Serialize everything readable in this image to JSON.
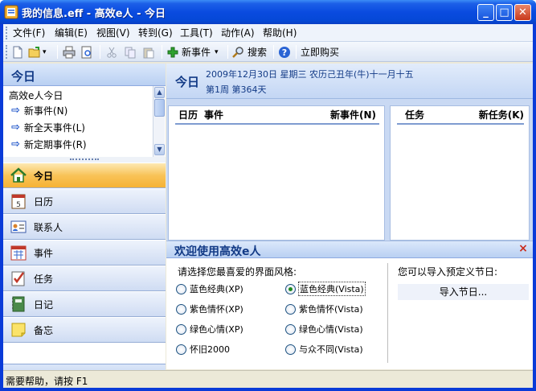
{
  "window": {
    "title": "我的信息.eff - 高效e人 - 今日",
    "min_glyph": "_",
    "max_glyph": "□",
    "close_glyph": "✕"
  },
  "menu": {
    "file": "文件(F)",
    "edit": "编辑(E)",
    "view": "视图(V)",
    "goto": "转到(G)",
    "tools": "工具(T)",
    "action": "动作(A)",
    "help": "帮助(H)"
  },
  "toolbar": {
    "new_event": "新事件",
    "search": "搜索",
    "buy_now": "立即购买",
    "dropdown_glyph": "▾"
  },
  "left": {
    "header": "今日",
    "subtitle": "高效e人今日",
    "quick_items": [
      {
        "label": "新事件(N)"
      },
      {
        "label": "新全天事件(L)"
      },
      {
        "label": "新定期事件(R)"
      }
    ],
    "nav": [
      {
        "label": "今日",
        "icon": "home-icon",
        "active": true
      },
      {
        "label": "日历",
        "icon": "calendar-icon",
        "active": false
      },
      {
        "label": "联系人",
        "icon": "contacts-icon",
        "active": false
      },
      {
        "label": "事件",
        "icon": "events-icon",
        "active": false
      },
      {
        "label": "任务",
        "icon": "tasks-icon",
        "active": false
      },
      {
        "label": "日记",
        "icon": "diary-icon",
        "active": false
      },
      {
        "label": "备忘",
        "icon": "memo-icon",
        "active": false
      }
    ],
    "footer_more_glyph": "»"
  },
  "date": {
    "heading": "今日",
    "line1": "2009年12月30日  星期三  农历己丑年(牛)十一月十五",
    "line2": "第1周  第364天"
  },
  "calendar_panel": {
    "col_calendar": "日历",
    "col_event": "事件",
    "new_event": "新事件(N)"
  },
  "task_panel": {
    "col_task": "任务",
    "new_task": "新任务(K)"
  },
  "welcome": {
    "title": "欢迎使用高效e人",
    "close_glyph": "×",
    "prompt": "请选择您最喜爱的界面风格:",
    "styles": [
      {
        "label": "蓝色经典(XP)",
        "selected": false
      },
      {
        "label": "蓝色经典(Vista)",
        "selected": true
      },
      {
        "label": "紫色情怀(XP)",
        "selected": false
      },
      {
        "label": "紫色情怀(Vista)",
        "selected": false
      },
      {
        "label": "绿色心情(XP)",
        "selected": false
      },
      {
        "label": "绿色心情(Vista)",
        "selected": false
      },
      {
        "label": "怀旧2000",
        "selected": false
      },
      {
        "label": "与众不同(Vista)",
        "selected": false
      }
    ],
    "import_prompt": "您可以导入预定义节日:",
    "import_button": "导入节日..."
  },
  "status": {
    "text": "需要帮助，请按 F1"
  },
  "colors": {
    "titlebar": "#0a4be0",
    "active_nav": "#f6b234",
    "header_text": "#123a86"
  }
}
